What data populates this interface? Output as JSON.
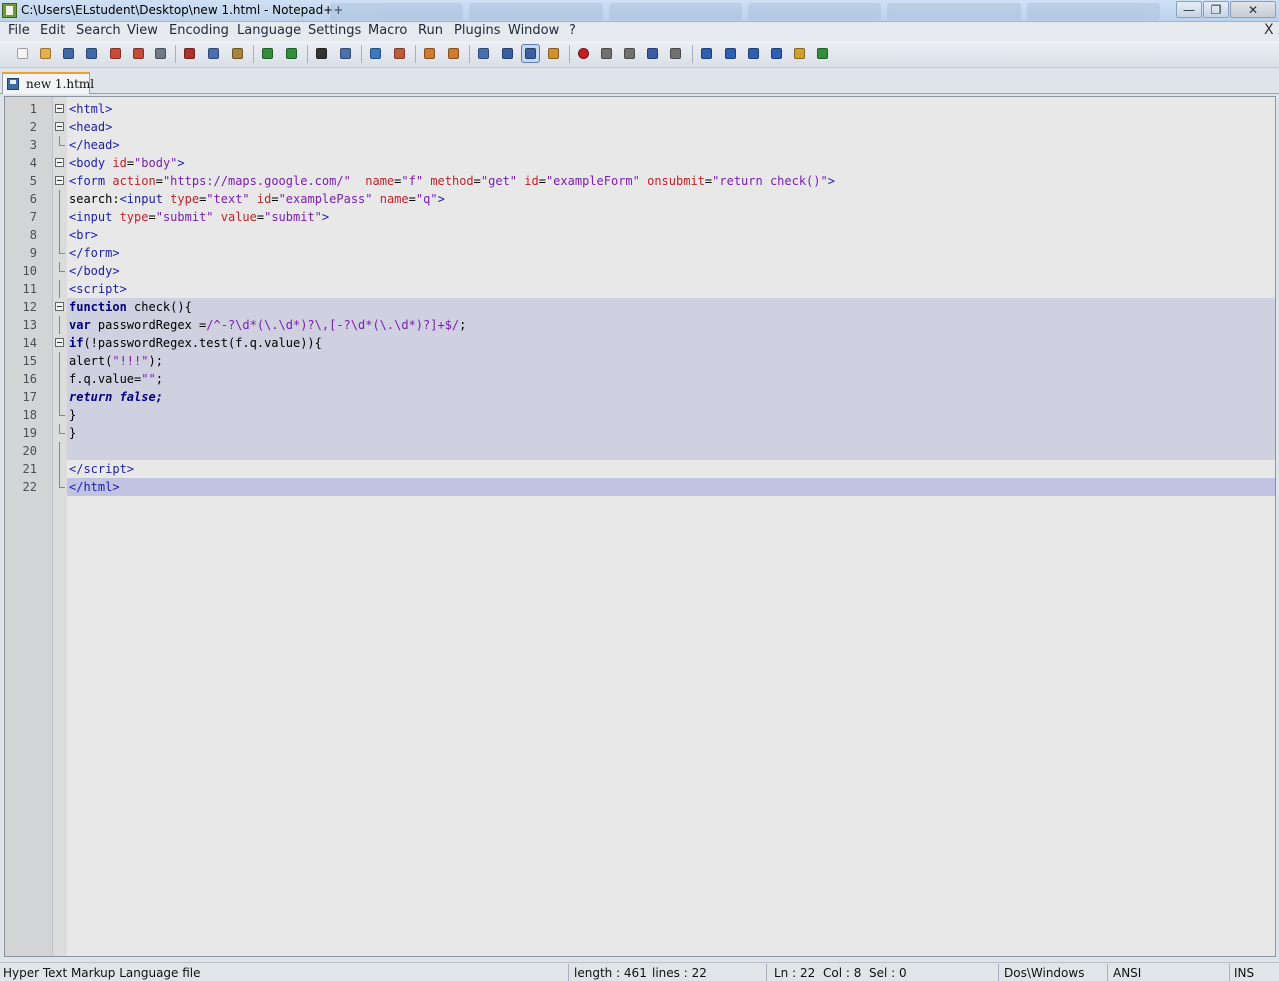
{
  "window": {
    "title": "C:\\Users\\ELstudent\\Desktop\\new  1.html - Notepad++",
    "close_doc": "X",
    "buttons": {
      "minimize": "—",
      "maximize": "❐",
      "close": "✕"
    }
  },
  "menu": [
    "File",
    "Edit",
    "Search",
    "View",
    "Encoding",
    "Language",
    "Settings",
    "Macro",
    "Run",
    "Plugins",
    "Window",
    "?"
  ],
  "toolbar": [
    {
      "name": "new-file-icon",
      "color": "#f4f4f4"
    },
    {
      "name": "open-file-icon",
      "color": "#e8b04a"
    },
    {
      "name": "save-icon",
      "color": "#3f6aa6"
    },
    {
      "name": "save-all-icon",
      "color": "#3f6aa6"
    },
    {
      "name": "close-icon",
      "color": "#c84a3a"
    },
    {
      "name": "close-all-icon",
      "color": "#c84a3a"
    },
    {
      "name": "print-icon",
      "color": "#707a88"
    },
    {
      "name": "cut-icon",
      "color": "#b03030"
    },
    {
      "name": "copy-icon",
      "color": "#4a6fb0"
    },
    {
      "name": "paste-icon",
      "color": "#a8833a"
    },
    {
      "name": "undo-icon",
      "color": "#2f8f3a"
    },
    {
      "name": "redo-icon",
      "color": "#2f8f3a"
    },
    {
      "name": "find-icon",
      "color": "#333333"
    },
    {
      "name": "replace-icon",
      "color": "#4a6fb0"
    },
    {
      "name": "zoom-in-icon",
      "color": "#3a78c0"
    },
    {
      "name": "zoom-out-icon",
      "color": "#c05a3a"
    },
    {
      "name": "sync-vertical-icon",
      "color": "#d07a30"
    },
    {
      "name": "sync-horizontal-icon",
      "color": "#d07a30"
    },
    {
      "name": "word-wrap-icon",
      "color": "#4a6fb0"
    },
    {
      "name": "show-all-chars-icon",
      "color": "#3a5fa0"
    },
    {
      "name": "indent-guide-icon",
      "color": "#3a5fa0"
    },
    {
      "name": "user-lang-icon",
      "color": "#d09030"
    },
    {
      "name": "record-macro-icon",
      "color": "#c02020"
    },
    {
      "name": "stop-macro-icon",
      "color": "#707070"
    },
    {
      "name": "play-macro-icon",
      "color": "#707070"
    },
    {
      "name": "run-macro-multiple-icon",
      "color": "#3a5fa0"
    },
    {
      "name": "save-macro-icon",
      "color": "#707070"
    },
    {
      "name": "collapse-icon",
      "color": "#2f5fb0"
    },
    {
      "name": "arrow-up-icon",
      "color": "#2f5fb0"
    },
    {
      "name": "arrow-down-icon",
      "color": "#2f5fb0"
    },
    {
      "name": "expand-icon",
      "color": "#2f5fb0"
    },
    {
      "name": "folder-icon",
      "color": "#d0a030"
    },
    {
      "name": "spellcheck-icon",
      "color": "#2f8f3a"
    }
  ],
  "tab": {
    "label": "new  1.html"
  },
  "editor": {
    "lines": [
      {
        "n": "1",
        "fold": "box",
        "html": "<span class='t-tag'>&lt;html&gt;</span>"
      },
      {
        "n": "2",
        "fold": "box",
        "html": "<span class='t-tag'>&lt;head&gt;</span>"
      },
      {
        "n": "3",
        "fold": "end",
        "html": "<span class='t-tag'>&lt;/head&gt;</span>"
      },
      {
        "n": "4",
        "fold": "box",
        "html": "<span class='t-tag'>&lt;body </span><span class='t-attr'>id</span>=<span class='t-str'>\"body\"</span><span class='t-tag'>&gt;</span>"
      },
      {
        "n": "5",
        "fold": "box",
        "html": "<span class='t-tag'>&lt;form </span><span class='t-attr'>action</span>=<span class='t-str'>\"https://maps.google.com/\"</span>  <span class='t-attr'>name</span>=<span class='t-str'>\"f\"</span> <span class='t-attr'>method</span>=<span class='t-str'>\"get\"</span> <span class='t-attr'>id</span>=<span class='t-str'>\"exampleForm\"</span> <span class='t-attr'>onsubmit</span>=<span class='t-str'>\"return check()\"</span><span class='t-tag'>&gt;</span>"
      },
      {
        "n": "6",
        "fold": "line",
        "html": "search:<span class='t-tag'>&lt;input </span><span class='t-attr'>type</span>=<span class='t-str'>\"text\"</span> <span class='t-attr'>id</span>=<span class='t-str'>\"examplePass\"</span> <span class='t-attr'>name</span>=<span class='t-str'>\"q\"</span><span class='t-tag'>&gt;</span>"
      },
      {
        "n": "7",
        "fold": "line",
        "html": "<span class='t-tag'>&lt;input </span><span class='t-attr'>type</span>=<span class='t-str'>\"submit\"</span> <span class='t-attr'>value</span>=<span class='t-str'>\"submit\"</span><span class='t-tag'>&gt;</span>"
      },
      {
        "n": "8",
        "fold": "line",
        "html": "<span class='t-tag'>&lt;br&gt;</span>"
      },
      {
        "n": "9",
        "fold": "end",
        "html": "<span class='t-tag'>&lt;/form&gt;</span>"
      },
      {
        "n": "10",
        "fold": "end",
        "html": "<span class='t-tag'>&lt;/body&gt;</span>"
      },
      {
        "n": "11",
        "fold": "line",
        "html": "<span class='t-tag'>&lt;script&gt;</span>"
      },
      {
        "n": "12",
        "fold": "box",
        "hl": true,
        "html": "<span class='t-kw'>function</span> check(){"
      },
      {
        "n": "13",
        "fold": "line",
        "hl": true,
        "html": "<span class='t-kw'>var</span> passwordRegex =<span class='t-str'>/^-?\\d*(\\.\\d*)?\\,[-?\\d*(\\.\\d*)?]+$/</span>;"
      },
      {
        "n": "14",
        "fold": "box",
        "hl": true,
        "html": "<span class='t-kw'>if</span>(!passwordRegex.test(f.q.value)){"
      },
      {
        "n": "15",
        "fold": "line",
        "hl": true,
        "html": "alert(<span class='t-str'>\"!!!\"</span>);"
      },
      {
        "n": "16",
        "fold": "line",
        "hl": true,
        "html": "f.q.value=<span class='t-str'>\"\"</span>;"
      },
      {
        "n": "17",
        "fold": "line",
        "hl": true,
        "html": "<span class='t-it'>return false;</span>"
      },
      {
        "n": "18",
        "fold": "end",
        "hl": true,
        "html": "}"
      },
      {
        "n": "19",
        "fold": "end",
        "hl": true,
        "html": "}"
      },
      {
        "n": "20",
        "fold": "line",
        "hl": true,
        "html": ""
      },
      {
        "n": "21",
        "fold": "line",
        "html": "<span class='t-tag'>&lt;/script&gt;</span>"
      },
      {
        "n": "22",
        "fold": "end",
        "cur": true,
        "html": "<span class='t-tag'>&lt;/html&gt;</span>"
      }
    ]
  },
  "status": {
    "filetype": "Hyper Text Markup Language file",
    "length": "length : 461",
    "lines": "lines : 22",
    "ln": "Ln : 22",
    "col": "Col : 8",
    "sel": "Sel : 0",
    "eol": "Dos\\Windows",
    "encoding": "ANSI",
    "mode": "INS"
  }
}
